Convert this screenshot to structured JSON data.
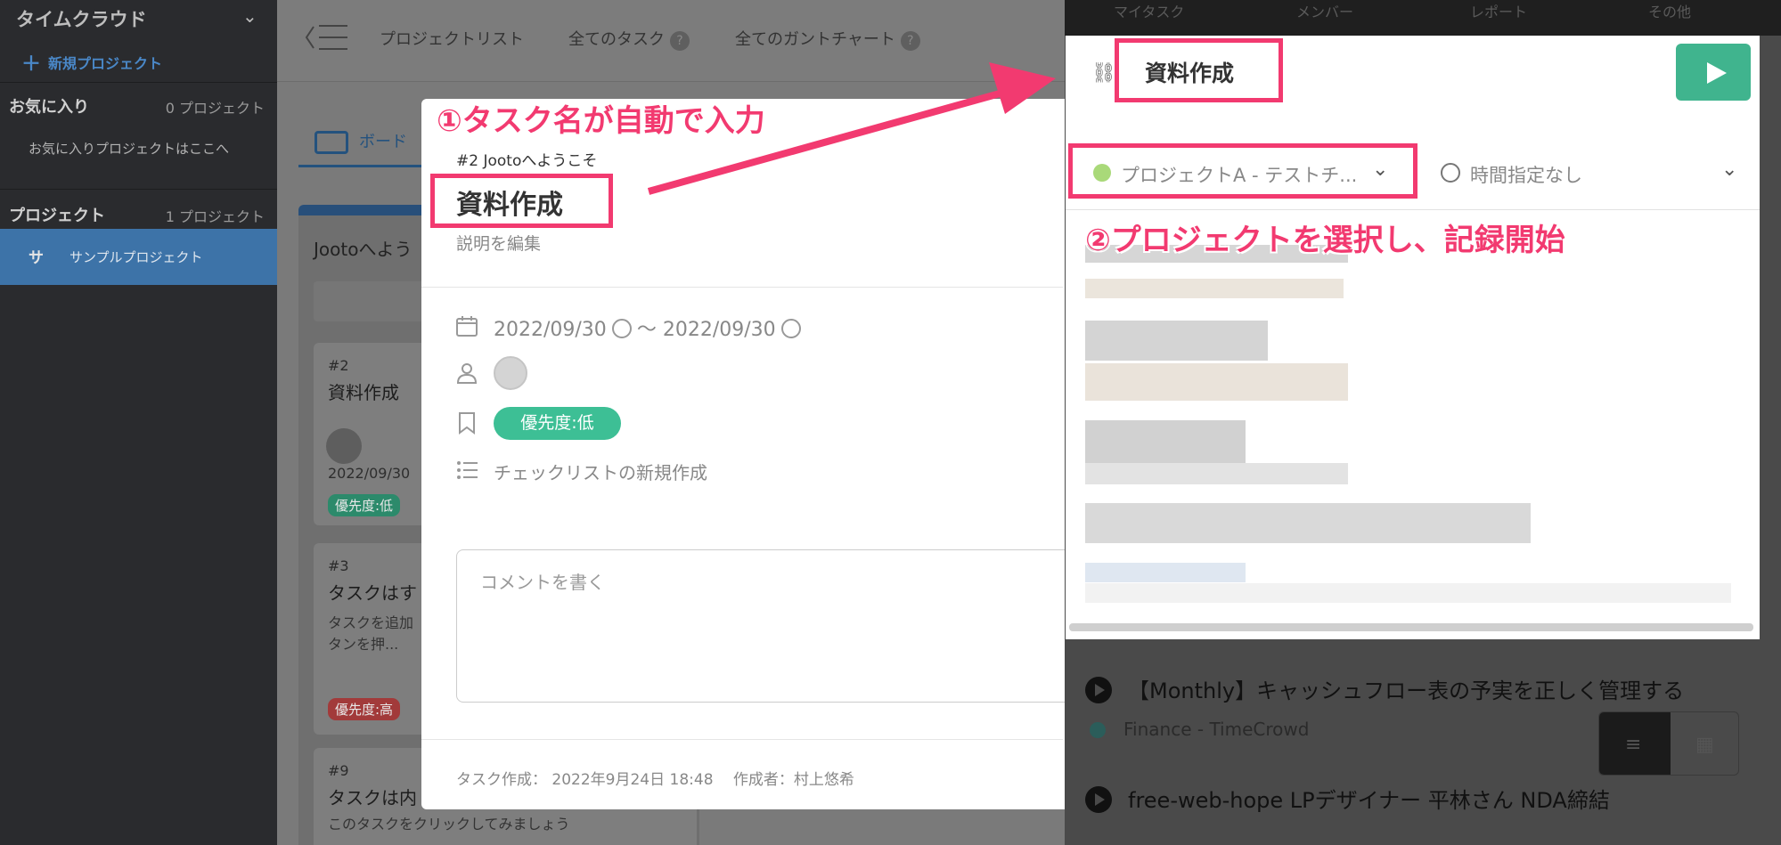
{
  "sidebar": {
    "brand": "タイムクラウド",
    "new_project": "新規プロジェクト",
    "favorites_header": "お気に入り",
    "favorites_count": "0 プロジェクト",
    "favorites_empty": "お気に入りプロジェクトはここへ",
    "projects_header": "プロジェクト",
    "projects_count": "1 プロジェクト",
    "project_initial": "サ",
    "project_name": "サンプルプロジェクト"
  },
  "topnav": {
    "items": [
      "プロジェクトリスト",
      "全てのタスク",
      "全てのガントチャート"
    ]
  },
  "board": {
    "tab_label": "ボード",
    "column_title": "Jootoへよう",
    "cards": [
      {
        "num": "#2",
        "title": "資料作成",
        "date": "2022/09/30",
        "badge": "優先度:低"
      },
      {
        "num": "#3",
        "title": "タスクはす",
        "desc1": "タスクを追加",
        "desc2": "タンを押...",
        "badge": "優先度:高"
      },
      {
        "num": "#9",
        "title": "タスクは内",
        "desc1": "このタスクをクリックしてみましょう"
      }
    ]
  },
  "modal": {
    "subtitle": "#2 Jootoへようこそ",
    "title": "資料作成",
    "desc_placeholder": "説明を編集",
    "date_start": "2022/09/30",
    "date_sep": "〜",
    "date_end": "2022/09/30",
    "priority": "優先度:低",
    "checklist": "チェックリストの新規作成",
    "comment_placeholder": "コメントを書く",
    "footer": "タスク作成： 2022年9月24日 18:48　 作成者：村上悠希"
  },
  "timer": {
    "top_tabs": [
      "マイタスク",
      "メンバー",
      "レポート",
      "その他"
    ],
    "task_name": "資料作成",
    "project": "プロジェクトA - テストチ...",
    "time": "時間指定なし",
    "list": [
      {
        "title": "【Monthly】キャッシュフロー表の予実を正しく管理する",
        "project": "Finance - TimeCrowd"
      },
      {
        "title": "free-web-hope LPデザイナー 平林さん NDA締結"
      }
    ]
  },
  "annotations": {
    "step1": "①タスク名が自動で入力",
    "step2": "②プロジェクトを選択し、記録開始"
  },
  "colors": {
    "highlight": "#f23a70",
    "priority_low": "#3dbf95",
    "priority_high": "#d84a4a",
    "play": "#40b48e",
    "sidebar_active": "#3d73a8"
  }
}
